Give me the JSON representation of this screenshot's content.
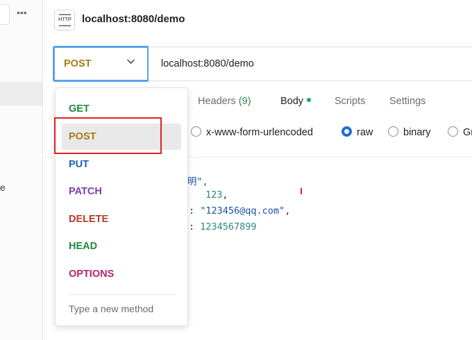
{
  "sidebar": {
    "more_glyph": "•••",
    "partial_char": "e"
  },
  "header": {
    "icon": "http-request-icon",
    "icon_text": "HTTP",
    "title": "localhost:8080/demo"
  },
  "request": {
    "method": "POST",
    "method_color": "#a77b13",
    "chevron": "chevron-down-icon",
    "url": "localhost:8080/demo"
  },
  "tabs": [
    {
      "label": "Headers",
      "count": "(9)",
      "active": false
    },
    {
      "label": "Body",
      "active": true,
      "indicator": "green-dot"
    },
    {
      "label": "Scripts",
      "active": false
    },
    {
      "label": "Settings",
      "active": false
    }
  ],
  "body_modes": [
    {
      "label": "x-www-form-urlencoded",
      "checked": false
    },
    {
      "label": "raw",
      "checked": true
    },
    {
      "label": "binary",
      "checked": false
    },
    {
      "label": "Gr",
      "checked": false
    }
  ],
  "code_lines": [
    {
      "parts": [
        {
          "t": "明\",",
          "c": "str"
        }
      ]
    },
    {
      "parts": [
        {
          "t": "123",
          "c": "num"
        },
        {
          "t": ",",
          "c": ""
        }
      ]
    },
    {
      "parts": [
        {
          "t": ": ",
          "c": ""
        },
        {
          "t": "\"123456@qq.com\"",
          "c": "str"
        },
        {
          "t": ",",
          "c": ""
        }
      ]
    },
    {
      "parts": [
        {
          "t": ": ",
          "c": ""
        },
        {
          "t": "1234567899",
          "c": "num"
        }
      ]
    }
  ],
  "method_menu": {
    "items": [
      {
        "label": "GET",
        "color": "#1d8a3e"
      },
      {
        "label": "POST",
        "color": "#a77b13",
        "highlighted": true
      },
      {
        "label": "PUT",
        "color": "#1f5fc0"
      },
      {
        "label": "PATCH",
        "color": "#7a3fae"
      },
      {
        "label": "DELETE",
        "color": "#b23a2a"
      },
      {
        "label": "HEAD",
        "color": "#1d8a3e"
      },
      {
        "label": "OPTIONS",
        "color": "#b2246e"
      }
    ],
    "new_method_placeholder": "Type a new method"
  },
  "annotation": {
    "color": "#e02020"
  }
}
